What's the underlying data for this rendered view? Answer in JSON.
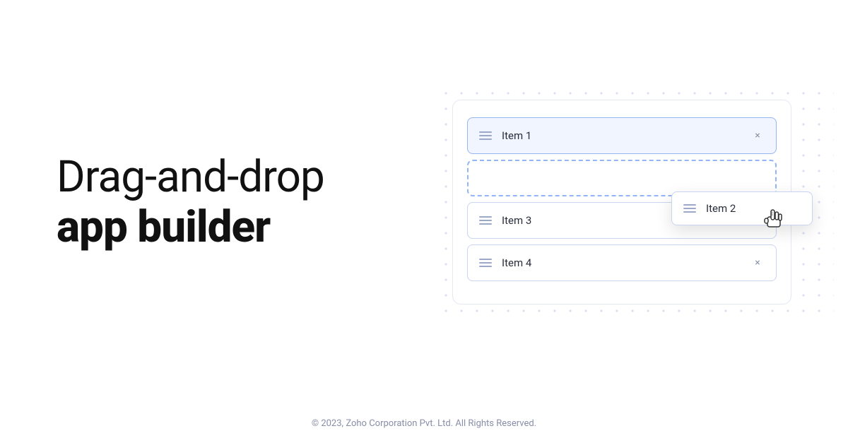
{
  "hero": {
    "line1": "Drag-and-drop",
    "line2": "app builder"
  },
  "demo": {
    "items": [
      {
        "id": "item1",
        "label": "Item 1",
        "type": "normal",
        "action": "close"
      },
      {
        "id": "item2-placeholder",
        "label": "",
        "type": "placeholder",
        "action": "none"
      },
      {
        "id": "item3",
        "label": "Item 3",
        "type": "normal",
        "action": "chevron"
      },
      {
        "id": "item4",
        "label": "Item 4",
        "type": "normal",
        "action": "close"
      }
    ],
    "dragged_item": {
      "label": "Item 2"
    }
  },
  "footer": {
    "text": "© 2023, Zoho Corporation Pvt. Ltd. All Rights Reserved."
  },
  "icons": {
    "close": "×",
    "chevron_down": "⌄",
    "drag_handle": "≡",
    "cursor": "☞"
  }
}
